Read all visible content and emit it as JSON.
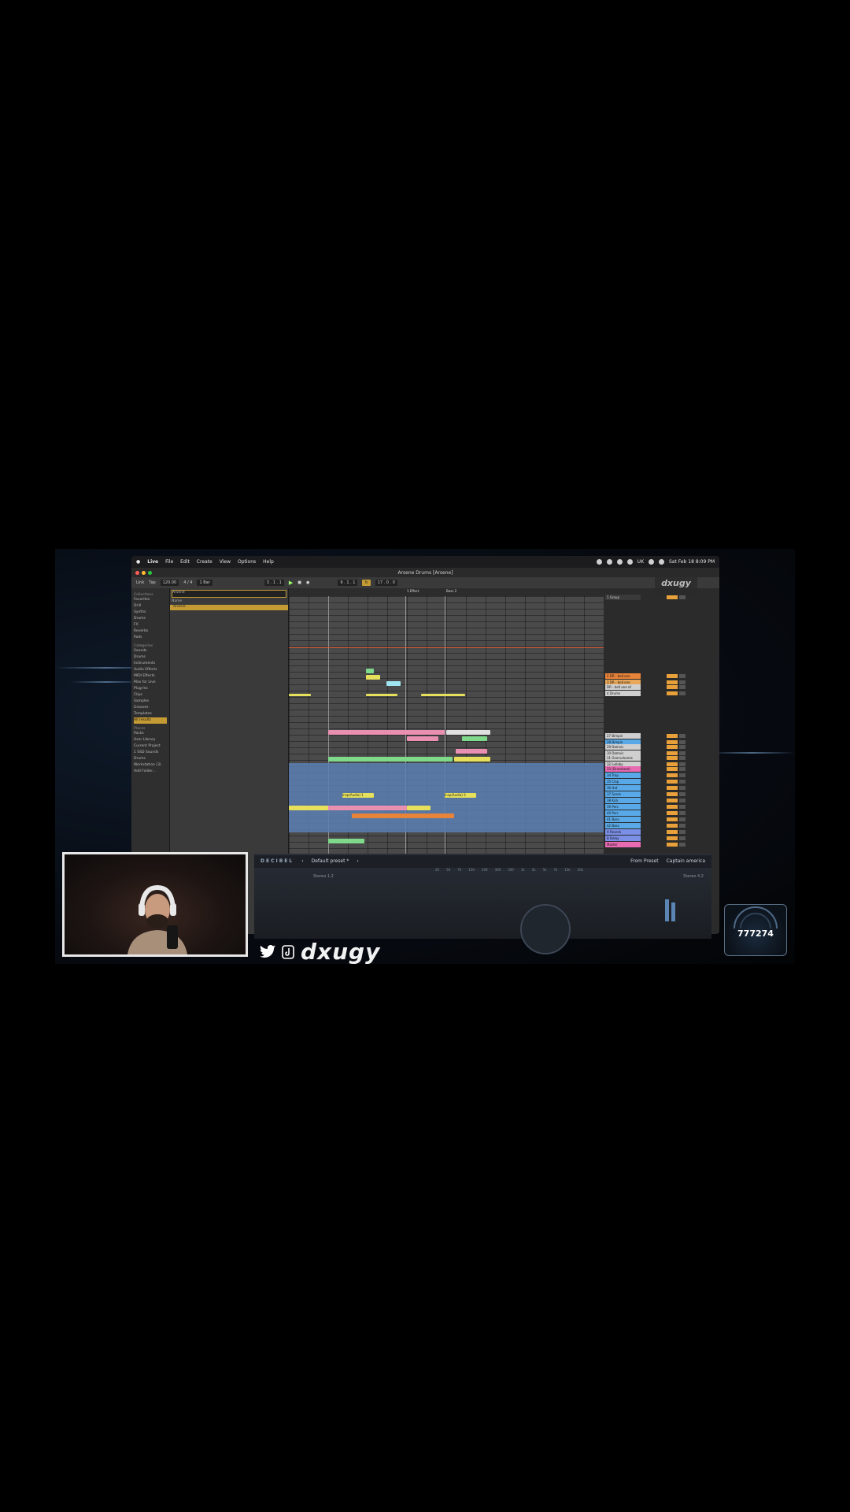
{
  "menubar": {
    "apple": "",
    "items": [
      "Live",
      "File",
      "Edit",
      "Create",
      "View",
      "Options",
      "Help"
    ],
    "clock": "Sat Feb 18 8:09 PM",
    "keyboard": "UK"
  },
  "window": {
    "title": "Arsene Drums [Arsene]"
  },
  "transport": {
    "link": "Link",
    "tap": "Tap",
    "tempo": "120.00",
    "time_sig": "4 / 4",
    "quantize": "1 Bar",
    "position": "3 . 1 . 1",
    "loop_start": "9 . 1 . 1",
    "loop_len": "17 . 0 . 0"
  },
  "browser": {
    "search_value": "Arsene",
    "collections_heading": "Collections",
    "collections": [
      "Favorites",
      "Drill",
      "Synths",
      "Drums",
      "FX",
      "Reverbs",
      "Pads"
    ],
    "categories_heading": "Categories",
    "categories": [
      "Sounds",
      "Drums",
      "Instruments",
      "Audio Effects",
      "MIDI Effects",
      "Max for Live",
      "Plug-Ins",
      "Clips",
      "Samples",
      "Grooves",
      "Templates",
      "All results"
    ],
    "places_heading": "Places",
    "places": [
      "Packs",
      "User Library",
      "Current Project",
      "1 SSD Sounds",
      "Drums",
      "Workstation (3)",
      "Add Folder..."
    ],
    "column_header": "Name",
    "selected_item": "Arsene"
  },
  "arrangement": {
    "locators": [
      "1 Effect",
      "Bass 2"
    ],
    "clip_labels": [
      "Insp(Audio) 1",
      "Insp(Audio) 3"
    ]
  },
  "tracks": [
    {
      "name": "1 Group",
      "color": "#3a3a3a"
    },
    {
      "name": "2 DR - bell.one",
      "color": "#e8833a"
    },
    {
      "name": "3 DR - bell.one",
      "color": "#e8a75a"
    },
    {
      "name": "DR - bell one of",
      "color": "#cfcfcf"
    },
    {
      "name": "4 Drums",
      "color": "#cfcfcf"
    },
    {
      "name": "27 Bimpin",
      "color": "#cfcfcf"
    },
    {
      "name": "28 Bimpin",
      "color": "#59a9e8"
    },
    {
      "name": "29 Damvic",
      "color": "#cfcfcf"
    },
    {
      "name": "30 Damvic",
      "color": "#cfcfcf"
    },
    {
      "name": "31 Overvolumes",
      "color": "#cfcfcf"
    },
    {
      "name": "32 Lullaby",
      "color": "#cfcfcf"
    },
    {
      "name": "33 (Drumbeat)",
      "color": "#e86bb2"
    },
    {
      "name": "34 Trap",
      "color": "#59a9e8"
    },
    {
      "name": "35 Clap",
      "color": "#59a9e8"
    },
    {
      "name": "36 Hat",
      "color": "#59a9e8"
    },
    {
      "name": "37 Snare",
      "color": "#59a9e8"
    },
    {
      "name": "38 Kick",
      "color": "#59a9e8"
    },
    {
      "name": "39 Perc",
      "color": "#59a9e8"
    },
    {
      "name": "40 Perc",
      "color": "#59a9e8"
    },
    {
      "name": "41 Bass",
      "color": "#59a9e8"
    },
    {
      "name": "42 Bass",
      "color": "#59a9e8"
    },
    {
      "name": "A Reverb",
      "color": "#7b8fe6"
    },
    {
      "name": "B Delay",
      "color": "#7b8fe6"
    },
    {
      "name": "Master",
      "color": "#e86bb2"
    }
  ],
  "device": {
    "brand": "DECIBEL",
    "preset": "Default preset *",
    "from_preset": "From Preset",
    "captain": "Captain america",
    "left_label": "Stereo 1.2",
    "right_label": "Stereo 4.2",
    "freq_labels": [
      "20",
      "50",
      "70",
      "100",
      "200",
      "300",
      "500",
      "1k",
      "2k",
      "5k",
      "7k",
      "10k",
      "20k"
    ]
  },
  "overlay": {
    "handle": "dxugy",
    "counter": "777274",
    "brand_mark": "dxugy"
  },
  "colors": {
    "accent": "#c49a34",
    "clip_blue": "#5b7fb3",
    "clip_pink": "#e98fb0",
    "clip_yellow": "#e6e05a",
    "clip_green": "#7fd98a"
  }
}
